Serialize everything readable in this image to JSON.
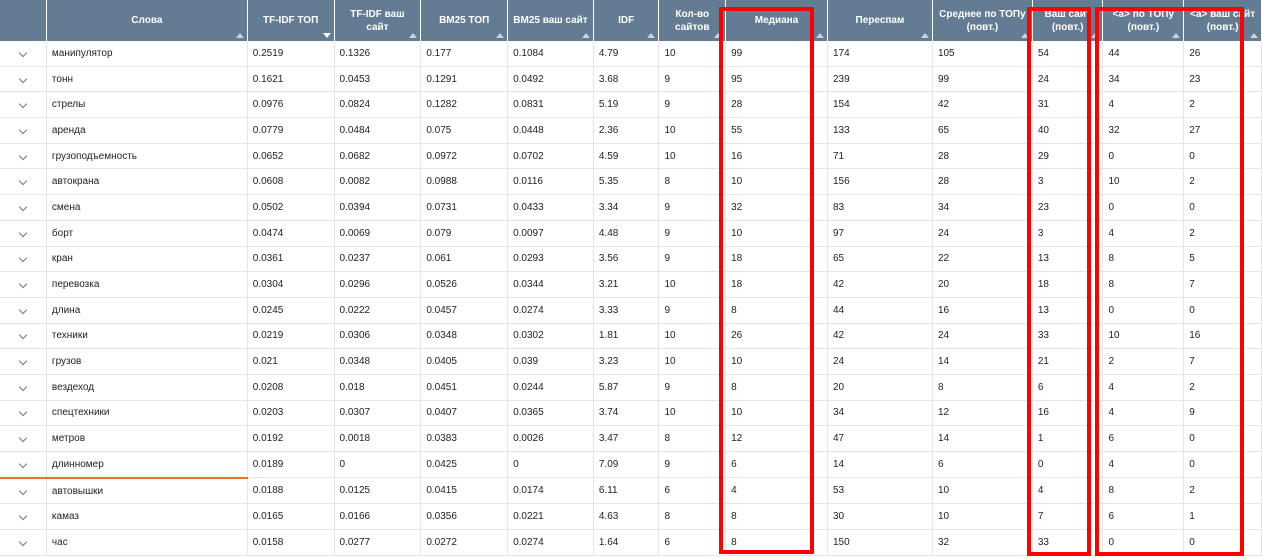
{
  "table": {
    "headers": [
      {
        "label": ""
      },
      {
        "label": "Слова"
      },
      {
        "label": "TF-IDF ТОП"
      },
      {
        "label": "TF-IDF ваш сайт"
      },
      {
        "label": "BM25 ТОП"
      },
      {
        "label": "BM25 ваш сайт"
      },
      {
        "label": "IDF"
      },
      {
        "label": "Кол-во сайтов"
      },
      {
        "label": "Медиана"
      },
      {
        "label": "Переспам"
      },
      {
        "label": "Среднее по ТОПу (повт.)"
      },
      {
        "label": "Ваш сайт (повт.)"
      },
      {
        "label": "<a> по ТОПу (повт.)"
      },
      {
        "label": "<a> ваш сайт (повт.)"
      }
    ],
    "sorted_column": "TF-IDF ТОП",
    "rows": [
      [
        "манипулятор",
        "0.2519",
        "0.1326",
        "0.177",
        "0.1084",
        "4.79",
        "10",
        "99",
        "174",
        "105",
        "54",
        "44",
        "26"
      ],
      [
        "тонн",
        "0.1621",
        "0.0453",
        "0.1291",
        "0.0492",
        "3.68",
        "9",
        "95",
        "239",
        "99",
        "24",
        "34",
        "23"
      ],
      [
        "стрелы",
        "0.0976",
        "0.0824",
        "0.1282",
        "0.0831",
        "5.19",
        "9",
        "28",
        "154",
        "42",
        "31",
        "4",
        "2"
      ],
      [
        "аренда",
        "0.0779",
        "0.0484",
        "0.075",
        "0.0448",
        "2.36",
        "10",
        "55",
        "133",
        "65",
        "40",
        "32",
        "27"
      ],
      [
        "грузоподъемность",
        "0.0652",
        "0.0682",
        "0.0972",
        "0.0702",
        "4.59",
        "10",
        "16",
        "71",
        "28",
        "29",
        "0",
        "0"
      ],
      [
        "автокрана",
        "0.0608",
        "0.0082",
        "0.0988",
        "0.0116",
        "5.35",
        "8",
        "10",
        "156",
        "28",
        "3",
        "10",
        "2"
      ],
      [
        "смена",
        "0.0502",
        "0.0394",
        "0.0731",
        "0.0433",
        "3.34",
        "9",
        "32",
        "83",
        "34",
        "23",
        "0",
        "0"
      ],
      [
        "борт",
        "0.0474",
        "0.0069",
        "0.079",
        "0.0097",
        "4.48",
        "9",
        "10",
        "97",
        "24",
        "3",
        "4",
        "2"
      ],
      [
        "кран",
        "0.0361",
        "0.0237",
        "0.061",
        "0.0293",
        "3.56",
        "9",
        "18",
        "65",
        "22",
        "13",
        "8",
        "5"
      ],
      [
        "перевозка",
        "0.0304",
        "0.0296",
        "0.0526",
        "0.0344",
        "3.21",
        "10",
        "18",
        "42",
        "20",
        "18",
        "8",
        "7"
      ],
      [
        "длина",
        "0.0245",
        "0.0222",
        "0.0457",
        "0.0274",
        "3.33",
        "9",
        "8",
        "44",
        "16",
        "13",
        "0",
        "0"
      ],
      [
        "техники",
        "0.0219",
        "0.0306",
        "0.0348",
        "0.0302",
        "1.81",
        "10",
        "26",
        "42",
        "24",
        "33",
        "10",
        "16"
      ],
      [
        "грузов",
        "0.021",
        "0.0348",
        "0.0405",
        "0.039",
        "3.23",
        "10",
        "10",
        "24",
        "14",
        "21",
        "2",
        "7"
      ],
      [
        "вездеход",
        "0.0208",
        "0.018",
        "0.0451",
        "0.0244",
        "5.87",
        "9",
        "8",
        "20",
        "8",
        "6",
        "4",
        "2"
      ],
      [
        "спецтехники",
        "0.0203",
        "0.0307",
        "0.0407",
        "0.0365",
        "3.74",
        "10",
        "10",
        "34",
        "12",
        "16",
        "4",
        "9"
      ],
      [
        "метров",
        "0.0192",
        "0.0018",
        "0.0383",
        "0.0026",
        "3.47",
        "8",
        "12",
        "47",
        "14",
        "1",
        "6",
        "0"
      ],
      [
        "длинномер",
        "0.0189",
        "0",
        "0.0425",
        "0",
        "7.09",
        "9",
        "6",
        "14",
        "6",
        "0",
        "4",
        "0"
      ],
      [
        "автовышки",
        "0.0188",
        "0.0125",
        "0.0415",
        "0.0174",
        "6.11",
        "6",
        "4",
        "53",
        "10",
        "4",
        "8",
        "2"
      ],
      [
        "камаз",
        "0.0165",
        "0.0166",
        "0.0356",
        "0.0221",
        "4.63",
        "8",
        "8",
        "30",
        "10",
        "7",
        "6",
        "1"
      ],
      [
        "час",
        "0.0158",
        "0.0277",
        "0.0272",
        "0.0274",
        "1.64",
        "6",
        "8",
        "150",
        "32",
        "33",
        "0",
        "0"
      ]
    ],
    "expand_icon": "chevron-down-icon"
  },
  "colors": {
    "header_bg": "#637c94",
    "highlight_box": "#ff0000",
    "row_separator_accent": "#e8742a"
  }
}
